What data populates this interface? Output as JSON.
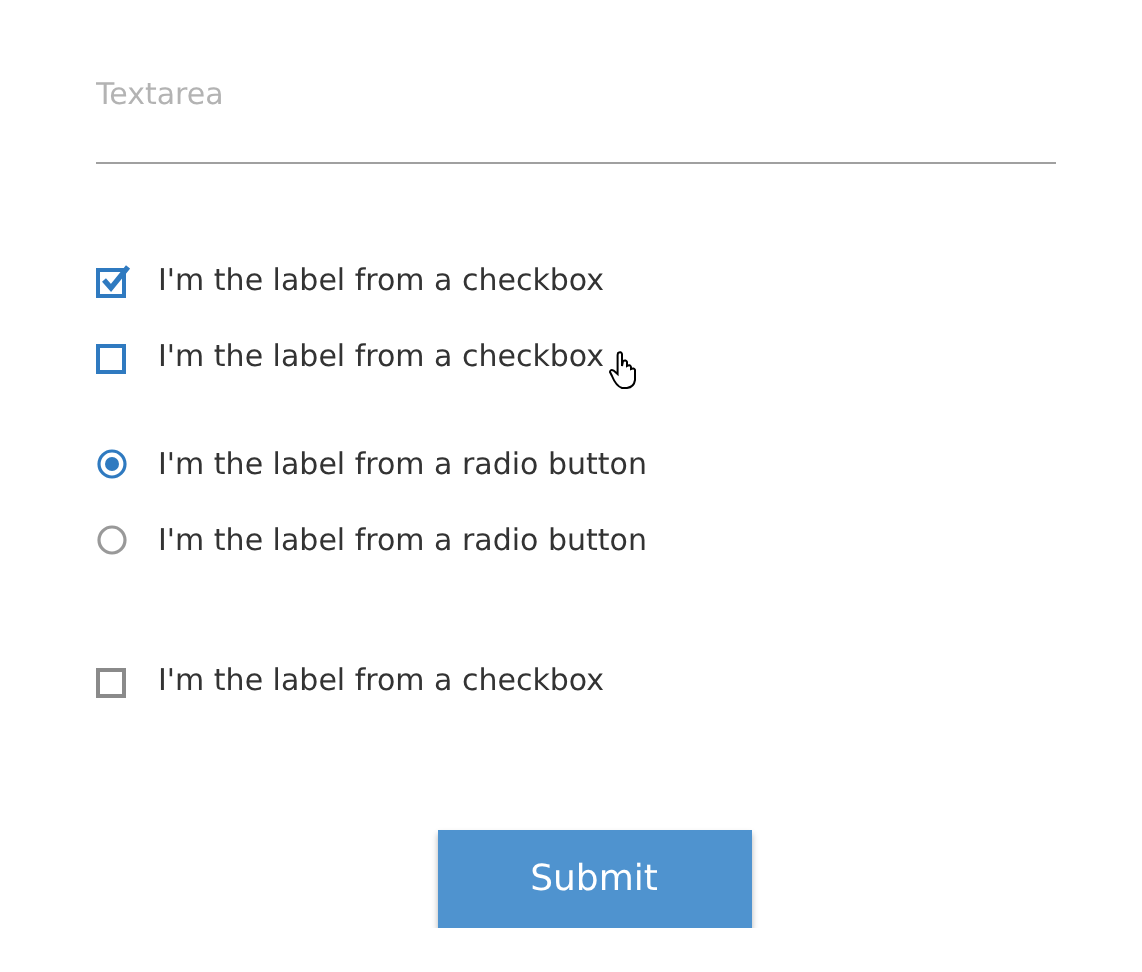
{
  "textarea": {
    "placeholder": "Textarea"
  },
  "groups": [
    {
      "items": [
        {
          "kind": "checkbox",
          "label": "I'm the label from a checkbox",
          "checked": true,
          "hovered": false
        },
        {
          "kind": "checkbox",
          "label": "I'm the label from a checkbox",
          "checked": false,
          "hovered": true
        }
      ]
    },
    {
      "items": [
        {
          "kind": "radio",
          "label": "I'm the label from a radio button",
          "selected": true
        },
        {
          "kind": "radio",
          "label": "I'm the label from a radio button",
          "selected": false
        }
      ]
    },
    {
      "items": [
        {
          "kind": "checkbox",
          "label": "I'm the label from a checkbox",
          "checked": false,
          "hovered": false
        }
      ]
    }
  ],
  "submit_button": "Submit"
}
